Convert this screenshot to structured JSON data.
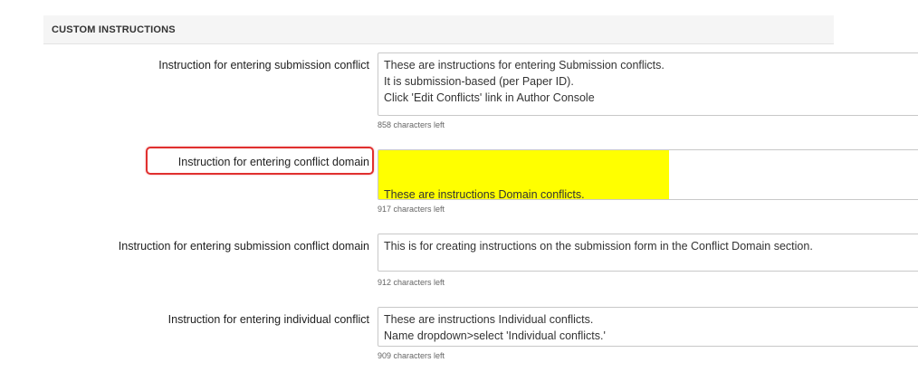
{
  "section": {
    "title": "CUSTOM INSTRUCTIONS"
  },
  "fields": [
    {
      "label": "Instruction for entering submission conflict",
      "value": "These are instructions for entering Submission conflicts.\nIt is submission-based (per Paper ID).\nClick 'Edit Conflicts' link in Author Console",
      "counter": "858 characters left"
    },
    {
      "label": "Instruction for entering conflict domain",
      "value": "These are instructions Domain conflicts.\nName dropdown>select 'domain conflicts.'",
      "counter": "917 characters left"
    },
    {
      "label": "Instruction for entering submission conflict domain",
      "value": "This is for creating instructions on the submission form in the Conflict Domain section.",
      "counter": "912 characters left"
    },
    {
      "label": "Instruction for entering individual conflict",
      "value": "These are instructions Individual conflicts.\nName dropdown>select 'Individual conflicts.'",
      "counter": "909 characters left"
    }
  ],
  "annotations": {
    "highlight_color": "#ffff00",
    "box_color": "#e0302f"
  }
}
